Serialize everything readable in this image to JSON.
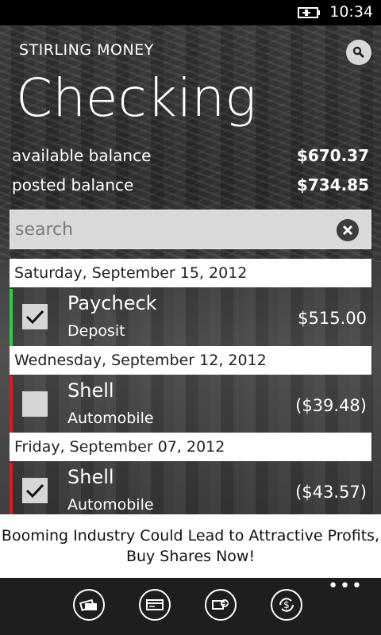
{
  "status_bar": {
    "time": "10:34",
    "battery_icon": "battery-charging-icon"
  },
  "header": {
    "app_name": "STIRLING MONEY",
    "title": "Checking",
    "search_icon": "search-icon"
  },
  "balances": {
    "available_label": "available balance",
    "available_value": "$670.37",
    "posted_label": "posted balance",
    "posted_value": "$734.85"
  },
  "search": {
    "placeholder": "search",
    "clear_icon": "close-circle-icon"
  },
  "transactions": [
    {
      "date": "Saturday, September 15, 2012",
      "payee": "Paycheck",
      "category": "Deposit",
      "amount": "$515.00",
      "checked": true,
      "indicator_color": "#2ecc40"
    },
    {
      "date": "Wednesday, September 12, 2012",
      "payee": "Shell",
      "category": "Automobile",
      "amount": "($39.48)",
      "checked": false,
      "indicator_color": "#e0181e"
    },
    {
      "date": "Friday, September 07, 2012",
      "payee": "Shell",
      "category": "Automobile",
      "amount": "($43.57)",
      "checked": true,
      "indicator_color": "#e0181e"
    }
  ],
  "ad": {
    "line1": "Booming Industry Could Lead to Attractive Profits,",
    "line2": "Buy Shares Now!"
  },
  "app_bar": {
    "buttons": [
      "cards-icon",
      "credit-card-icon",
      "money-transfer-icon",
      "dollar-refresh-icon"
    ],
    "more": "•••"
  }
}
